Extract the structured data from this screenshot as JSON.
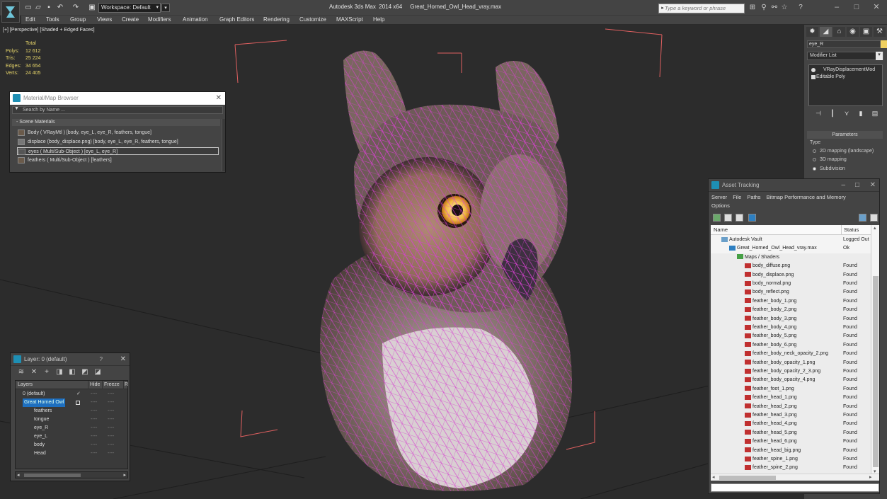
{
  "titlebar": {
    "title": "Autodesk 3ds Max  2014 x64     Great_Horned_Owl_Head_vray.max",
    "workspace": "Workspace: Default",
    "search_placeholder": "Type a keyword or phrase"
  },
  "menu": [
    "Edit",
    "Tools",
    "Group",
    "Views",
    "Create",
    "Modifiers",
    "Animation",
    "Graph Editors",
    "Rendering",
    "Customize",
    "MAXScript",
    "Help"
  ],
  "viewport": {
    "label": "[+] [Perspective] [Shaded + Edged Faces]",
    "stats_header": "Total",
    "stats": [
      {
        "label": "Polys:",
        "value": "12 612"
      },
      {
        "label": "Tris:",
        "value": "25 224"
      },
      {
        "label": "Edges:",
        "value": "34 654"
      },
      {
        "label": "Verts:",
        "value": "24 405"
      }
    ]
  },
  "material_browser": {
    "title": "Material/Map Browser",
    "search_placeholder": "Search by Name ...",
    "section": "- Scene Materials",
    "materials": [
      "Body  ( VRayMtl ) [body, eye_L, eye_R, feathers, tongue]",
      "displace (body_displace.png) [body, eye_L, eye_R, feathers, tongue]",
      "eyes  ( Multi/Sub-Object ) [eye_L, eye_R]",
      "feathers  ( Multi/Sub-Object ) [feathers]"
    ]
  },
  "layer_dialog": {
    "title": "Layer: 0 (default)",
    "help": "?",
    "col_layers": "Layers",
    "col_hide": "Hide",
    "col_freeze": "Freeze",
    "col_r": "R",
    "rows": [
      {
        "name": "0 (default)",
        "indent": 0
      },
      {
        "name": "Great Horned Owl",
        "indent": 0
      },
      {
        "name": "feathers",
        "indent": 1
      },
      {
        "name": "tongue",
        "indent": 1
      },
      {
        "name": "eye_R",
        "indent": 1
      },
      {
        "name": "eye_L",
        "indent": 1
      },
      {
        "name": "body",
        "indent": 1
      },
      {
        "name": "Head",
        "indent": 1
      }
    ],
    "dash": "----"
  },
  "command_panel": {
    "object_name": "eye_R",
    "modifier_list": "Modifier List",
    "stack": [
      "VRayDisplacementMod",
      "Editable Poly"
    ],
    "params_title": "Parameters",
    "type_label": "Type",
    "radio_options": [
      "2D mapping (landscape)",
      "3D mapping",
      "Subdivision"
    ],
    "radio_selected": 2
  },
  "asset_tracking": {
    "title": "Asset Tracking",
    "menu": [
      "Server",
      "File",
      "Paths",
      "Bitmap Performance and Memory",
      "Options"
    ],
    "col_name": "Name",
    "col_status": "Status",
    "rows": [
      {
        "name": "Autodesk Vault",
        "status": "Logged Out",
        "indent": 1,
        "icon": "vault"
      },
      {
        "name": "Great_Horned_Owl_Head_vray.max",
        "status": "Ok",
        "indent": 2,
        "icon": "max"
      },
      {
        "name": "Maps / Shaders",
        "status": "",
        "indent": 3,
        "icon": "maps"
      },
      {
        "name": "body_diffuse.png",
        "status": "Found",
        "indent": 4,
        "icon": "png"
      },
      {
        "name": "body_displace.png",
        "status": "Found",
        "indent": 4,
        "icon": "png"
      },
      {
        "name": "body_normal.png",
        "status": "Found",
        "indent": 4,
        "icon": "png"
      },
      {
        "name": "body_reflect.png",
        "status": "Found",
        "indent": 4,
        "icon": "png"
      },
      {
        "name": "feather_body_1.png",
        "status": "Found",
        "indent": 4,
        "icon": "png"
      },
      {
        "name": "feather_body_2.png",
        "status": "Found",
        "indent": 4,
        "icon": "png"
      },
      {
        "name": "feather_body_3.png",
        "status": "Found",
        "indent": 4,
        "icon": "png"
      },
      {
        "name": "feather_body_4.png",
        "status": "Found",
        "indent": 4,
        "icon": "png"
      },
      {
        "name": "feather_body_5.png",
        "status": "Found",
        "indent": 4,
        "icon": "png"
      },
      {
        "name": "feather_body_6.png",
        "status": "Found",
        "indent": 4,
        "icon": "png"
      },
      {
        "name": "feather_body_neck_opacity_2.png",
        "status": "Found",
        "indent": 4,
        "icon": "png"
      },
      {
        "name": "feather_body_opacity_1.png",
        "status": "Found",
        "indent": 4,
        "icon": "png"
      },
      {
        "name": "feather_body_opacity_2_3.png",
        "status": "Found",
        "indent": 4,
        "icon": "png"
      },
      {
        "name": "feather_body_opacity_4.png",
        "status": "Found",
        "indent": 4,
        "icon": "png"
      },
      {
        "name": "feather_foot_1.png",
        "status": "Found",
        "indent": 4,
        "icon": "png"
      },
      {
        "name": "feather_head_1.png",
        "status": "Found",
        "indent": 4,
        "icon": "png"
      },
      {
        "name": "feather_head_2.png",
        "status": "Found",
        "indent": 4,
        "icon": "png"
      },
      {
        "name": "feather_head_3.png",
        "status": "Found",
        "indent": 4,
        "icon": "png"
      },
      {
        "name": "feather_head_4.png",
        "status": "Found",
        "indent": 4,
        "icon": "png"
      },
      {
        "name": "feather_head_5.png",
        "status": "Found",
        "indent": 4,
        "icon": "png"
      },
      {
        "name": "feather_head_6.png",
        "status": "Found",
        "indent": 4,
        "icon": "png"
      },
      {
        "name": "feather_head_big.png",
        "status": "Found",
        "indent": 4,
        "icon": "png"
      },
      {
        "name": "feather_spine_1.png",
        "status": "Found",
        "indent": 4,
        "icon": "png"
      },
      {
        "name": "feather_spine_2.png",
        "status": "Found",
        "indent": 4,
        "icon": "png"
      }
    ]
  },
  "colors": {
    "wire": "#d640d0",
    "stats": "#e8d66a",
    "selection": "#1e6fbf"
  }
}
